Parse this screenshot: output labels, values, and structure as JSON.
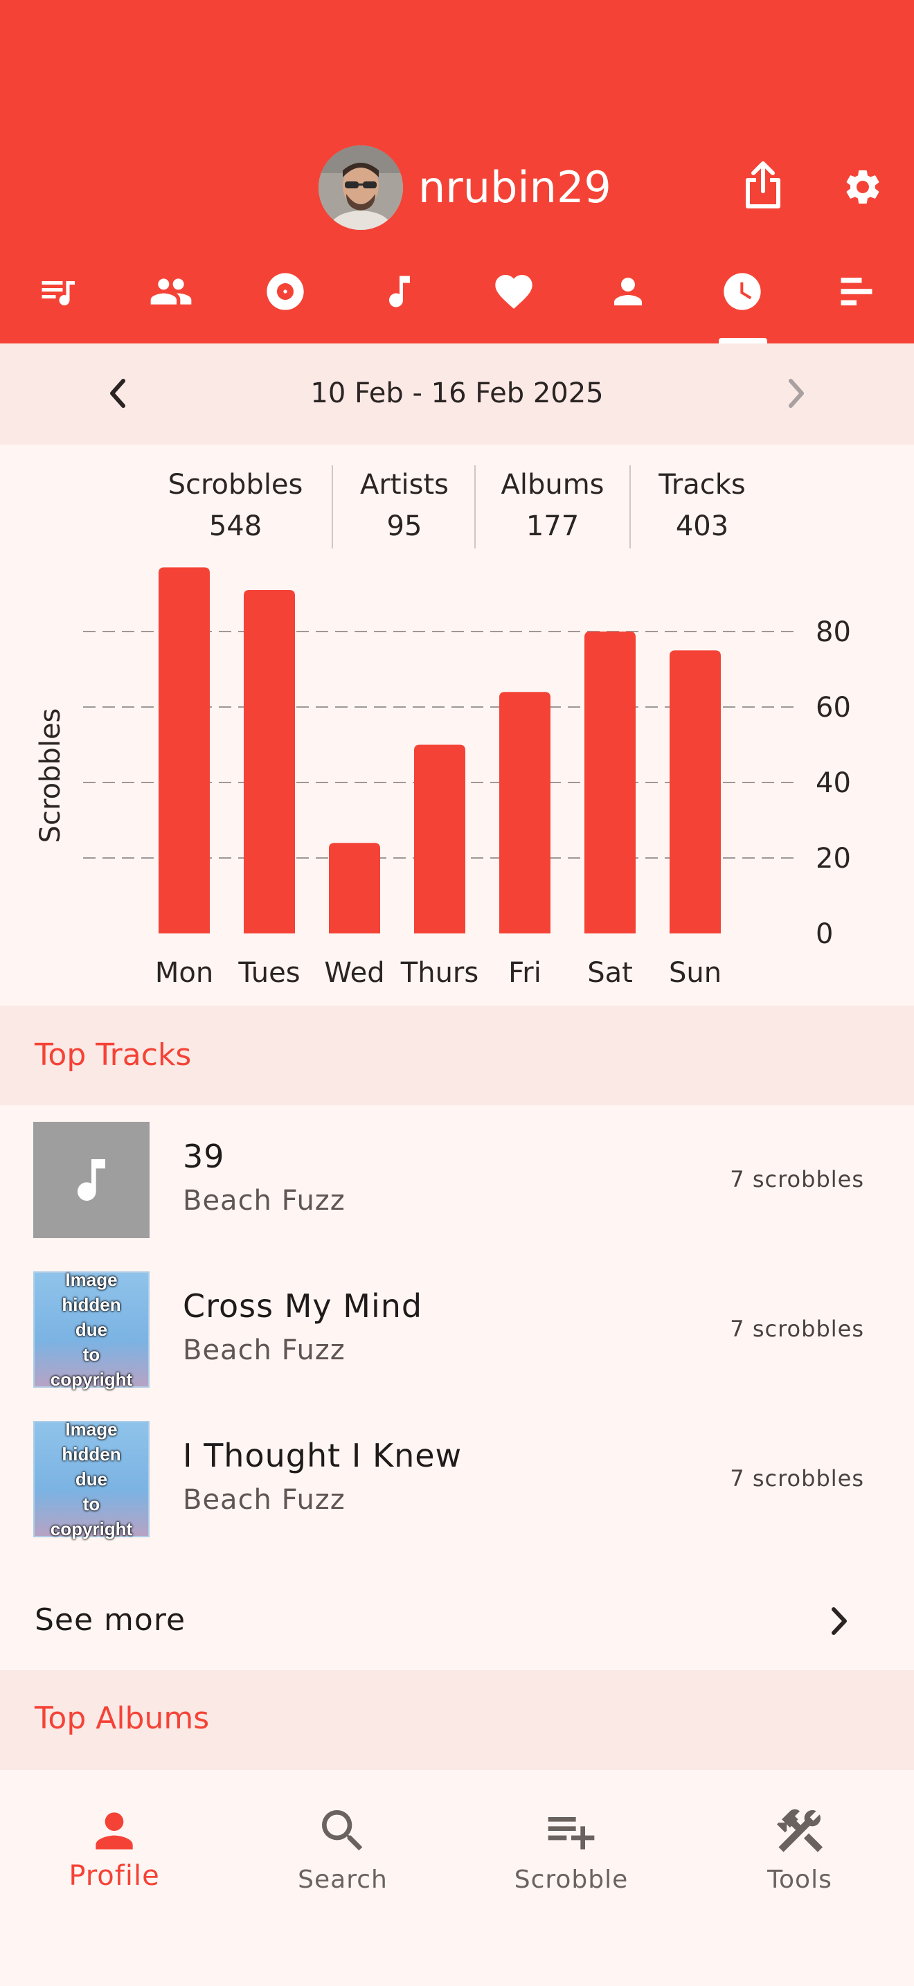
{
  "header": {
    "username": "nrubin29",
    "tabs": [
      "scrobbles-tab",
      "friends-tab",
      "albums-tab",
      "tracks-tab",
      "loved-tab",
      "artists-tab",
      "history-tab",
      "charts-tab"
    ],
    "selected_tab": "history-tab"
  },
  "week": {
    "label": "10 Feb - 16 Feb 2025"
  },
  "stats": [
    {
      "label": "Scrobbles",
      "value": "548"
    },
    {
      "label": "Artists",
      "value": "95"
    },
    {
      "label": "Albums",
      "value": "177"
    },
    {
      "label": "Tracks",
      "value": "403"
    }
  ],
  "chart_data": {
    "type": "bar",
    "categories": [
      "Mon",
      "Tues",
      "Wed",
      "Thurs",
      "Fri",
      "Sat",
      "Sun"
    ],
    "values": [
      97,
      91,
      24,
      50,
      64,
      80,
      75
    ],
    "ylabel": "Scrobbles",
    "yticks": [
      "0",
      "20",
      "40",
      "60",
      "80"
    ],
    "ylim": [
      0,
      100
    ],
    "grid": "dashed-horizontal",
    "color": "#f44336"
  },
  "top_tracks": {
    "title": "Top Tracks",
    "items": [
      {
        "title": "39",
        "artist": "Beach Fuzz",
        "count": "7 scrobbles",
        "art": "music-note"
      },
      {
        "title": "Cross My Mind",
        "artist": "Beach Fuzz",
        "count": "7 scrobbles",
        "art": "hidden"
      },
      {
        "title": "I Thought I Knew",
        "artist": "Beach Fuzz",
        "count": "7 scrobbles",
        "art": "hidden"
      }
    ],
    "hidden_art_text": "Image hidden due to copyright",
    "see_more": "See more"
  },
  "top_albums": {
    "title": "Top Albums"
  },
  "bottom_nav": [
    {
      "label": "Profile",
      "icon": "person-icon",
      "active": true
    },
    {
      "label": "Search",
      "icon": "search-icon",
      "active": false
    },
    {
      "label": "Scrobble",
      "icon": "playlist-add-icon",
      "active": false
    },
    {
      "label": "Tools",
      "icon": "tools-icon",
      "active": false
    }
  ],
  "colors": {
    "accent": "#f44336",
    "background": "#fff6f4",
    "section": "#fbe9e6"
  }
}
